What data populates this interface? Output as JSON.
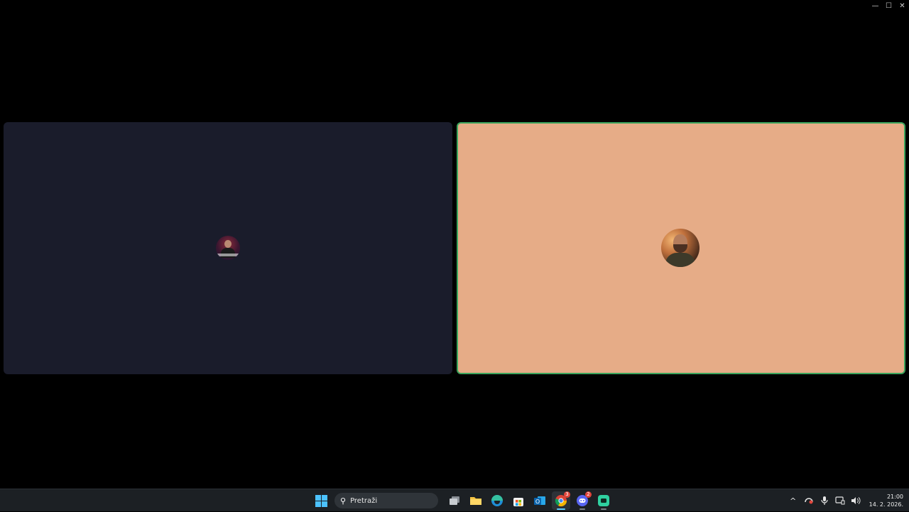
{
  "window": {
    "controls": {
      "minimize": "—",
      "maximize": "☐",
      "close": "✕"
    }
  },
  "participants": [
    {
      "id": "left",
      "speaking": false,
      "tile_color": "#1a1c2b"
    },
    {
      "id": "right",
      "speaking": true,
      "tile_color": "#e6ac87",
      "border_color": "#3ba55d"
    }
  ],
  "taskbar": {
    "search": {
      "placeholder": "Pretraži",
      "icon": "search-icon"
    },
    "apps": [
      {
        "name": "task-view",
        "icon": "task-view-icon"
      },
      {
        "name": "file-explorer",
        "icon": "folder-icon"
      },
      {
        "name": "edge",
        "icon": "edge-icon"
      },
      {
        "name": "microsoft-store",
        "icon": "store-icon"
      },
      {
        "name": "outlook",
        "icon": "outlook-icon"
      },
      {
        "name": "chrome",
        "icon": "chrome-icon",
        "badge": "3"
      },
      {
        "name": "discord",
        "icon": "discord-icon",
        "badge": "2"
      },
      {
        "name": "app",
        "icon": "green-app-icon"
      }
    ],
    "tray": {
      "chevron": "^",
      "clock": {
        "time": "21:00",
        "date": "14. 2. 2026."
      }
    }
  }
}
